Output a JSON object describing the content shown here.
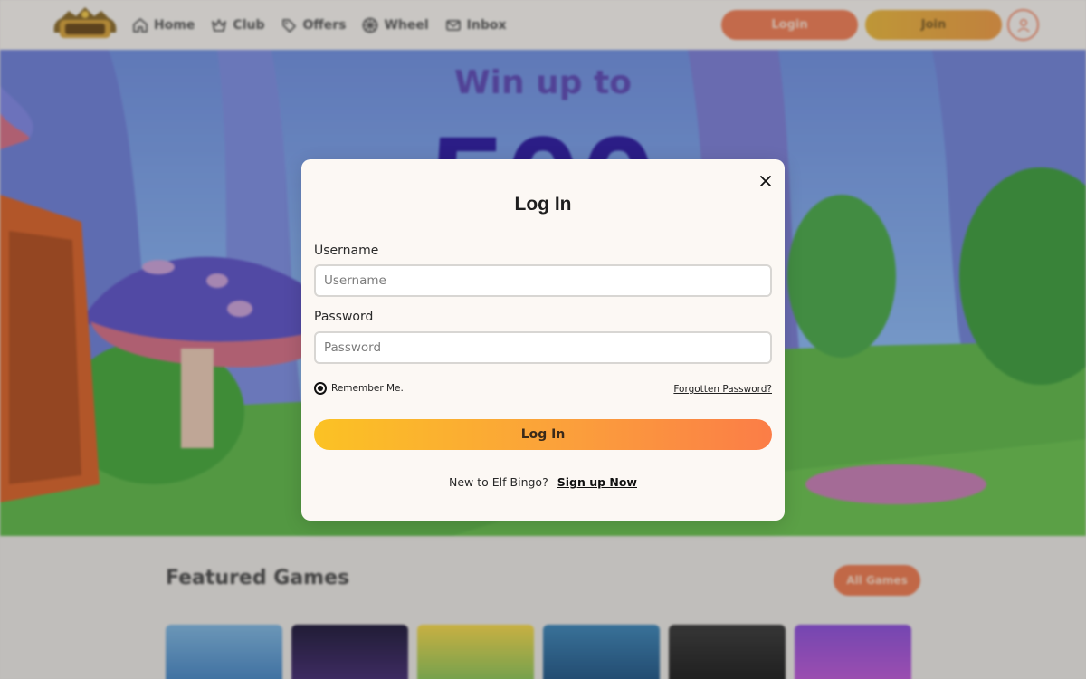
{
  "topbar": {
    "nav": [
      {
        "label": "Home",
        "icon": "home-icon"
      },
      {
        "label": "Club",
        "icon": "crown-icon"
      },
      {
        "label": "Offers",
        "icon": "tag-icon"
      },
      {
        "label": "Wheel",
        "icon": "wheel-icon"
      },
      {
        "label": "Inbox",
        "icon": "mail-icon"
      }
    ],
    "login_label": "Login",
    "join_label": "Join",
    "avatar_icon": "user-icon"
  },
  "hero": {
    "headline": "Win up to"
  },
  "featured": {
    "title": "Featured Games",
    "all_games_label": "All Games",
    "tile_count_visible": 6
  },
  "modal": {
    "title": "Log In",
    "close_icon": "close-icon",
    "username_label": "Username",
    "username_placeholder": "Username",
    "username_value": "",
    "password_label": "Password",
    "password_placeholder": "Password",
    "password_value": "",
    "remember_label": "Remember Me.",
    "remember_checked": true,
    "forgot_label": "Forgotten Password?",
    "submit_label": "Log In",
    "signup_prompt": "New to Elf Bingo?",
    "signup_link": "Sign up Now"
  },
  "colors": {
    "accent_orange": "#ef7d55",
    "accent_yellow": "#fbc224",
    "modal_bg": "#fcf8f4",
    "headline_purple": "#5d4ab5"
  }
}
